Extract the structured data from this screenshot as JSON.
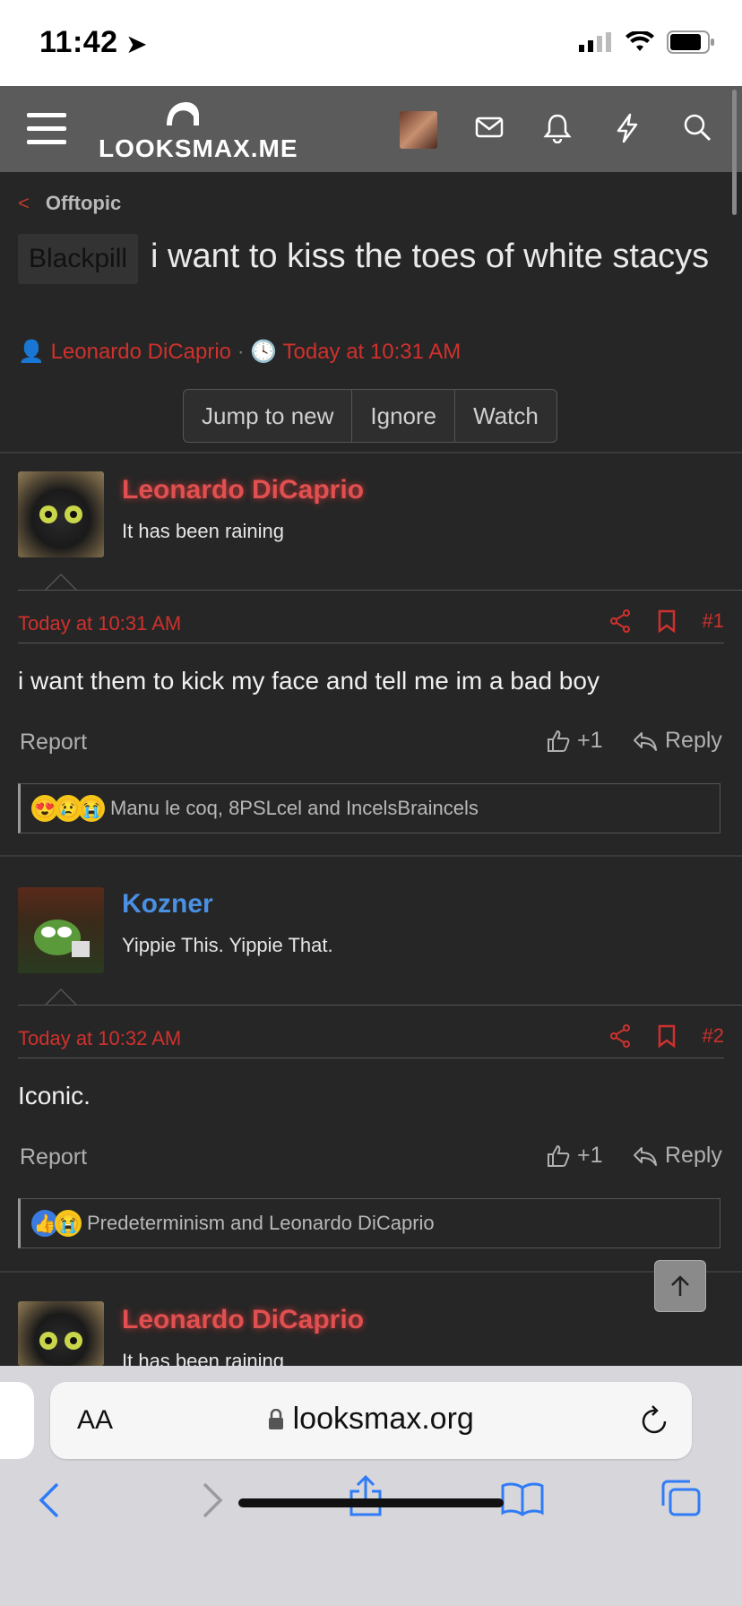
{
  "status": {
    "time": "11:42"
  },
  "header": {
    "logo": "LOOKSMAX.ME"
  },
  "breadcrumb": {
    "label": "Offtopic"
  },
  "thread": {
    "prefix": "Blackpill",
    "title": "i want to kiss the toes of white stacys",
    "author": "Leonardo DiCaprio",
    "separator": "·",
    "time": "Today at 10:31 AM"
  },
  "buttons": {
    "jump": "Jump to new",
    "ignore": "Ignore",
    "watch": "Watch"
  },
  "posts": [
    {
      "user": "Leonardo DiCaprio",
      "user_title": "It has been raining",
      "time": "Today at 10:31 AM",
      "num": "#1",
      "body": "i want them to kick my face and tell me im a bad boy",
      "report": "Report",
      "likes": "+1",
      "reply": "Reply",
      "reactions": "Manu le coq, 8PSLcel and IncelsBraincels"
    },
    {
      "user": "Kozner",
      "user_title": "Yippie This. Yippie That.",
      "time": "Today at 10:32 AM",
      "num": "#2",
      "body": "Iconic.",
      "report": "Report",
      "likes": "+1",
      "reply": "Reply",
      "reactions": "Predeterminism and Leonardo DiCaprio"
    },
    {
      "user": "Leonardo DiCaprio",
      "user_title": "It has been raining"
    }
  ],
  "browser": {
    "aa": "AA",
    "url": "looksmax.org"
  },
  "colors": {
    "accent": "#d0312d",
    "user_blue": "#4a90e2",
    "header": "#5b5b5b",
    "bg": "#262626"
  }
}
